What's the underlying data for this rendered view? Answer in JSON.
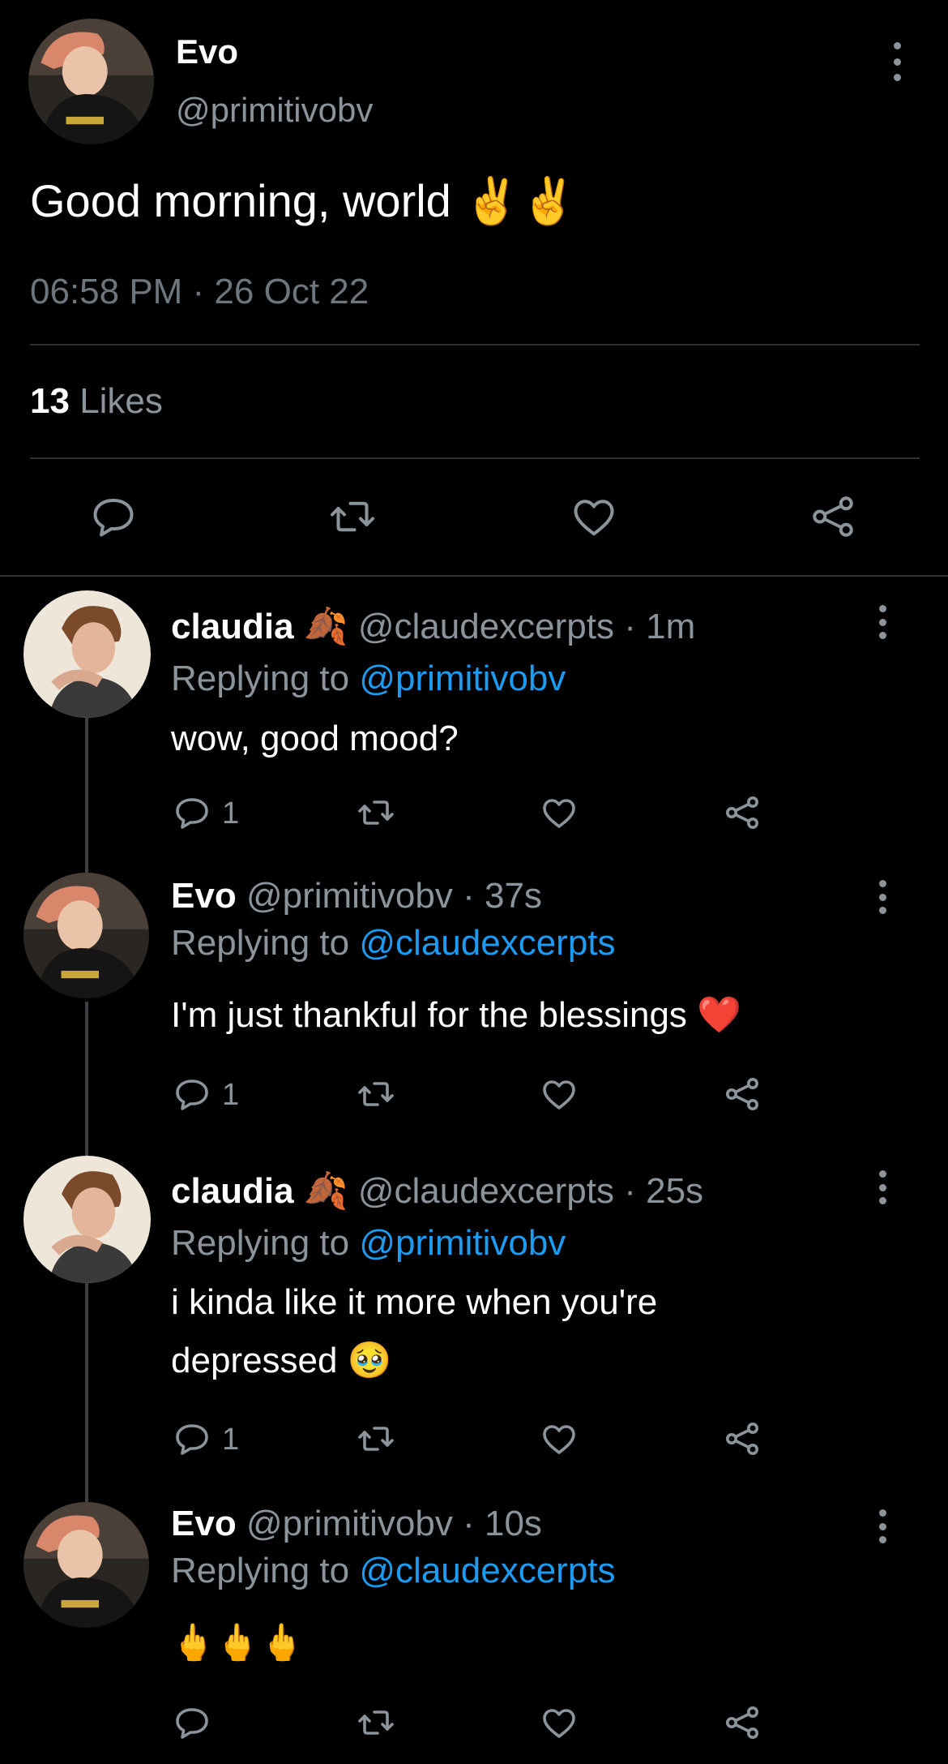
{
  "main_tweet": {
    "author_name": "Evo",
    "author_handle": "@primitivobv",
    "text": "Good morning, world ✌️✌️",
    "timestamp": "06:58 PM · 26 Oct 22",
    "likes_count": "13",
    "likes_label": "Likes"
  },
  "replies": [
    {
      "name": "claudia 🍂",
      "meta": "@claudexcerpts · 1m",
      "replying_label": "Replying to",
      "replying_to": "@primitivobv",
      "text": "wow, good mood?",
      "reply_count": "1"
    },
    {
      "name": "Evo",
      "meta": "@primitivobv · 37s",
      "replying_label": "Replying to",
      "replying_to": "@claudexcerpts",
      "text": "I'm just thankful for the blessings ❤️",
      "reply_count": "1"
    },
    {
      "name": "claudia 🍂",
      "meta": "@claudexcerpts · 25s",
      "replying_label": "Replying to",
      "replying_to": "@primitivobv",
      "text": "i kinda like it more when you're depressed 🥹",
      "reply_count": "1"
    },
    {
      "name": "Evo",
      "meta": "@primitivobv · 10s",
      "replying_label": "Replying to",
      "replying_to": "@claudexcerpts",
      "text": "🖕🖕🖕",
      "reply_count": ""
    }
  ],
  "colors": {
    "background": "#000000",
    "muted_text": "#8b949b",
    "link": "#1d9bf0",
    "divider": "#2f3336"
  },
  "icons": [
    "more-vertical-icon",
    "reply-icon",
    "retweet-icon",
    "like-icon",
    "share-icon"
  ]
}
